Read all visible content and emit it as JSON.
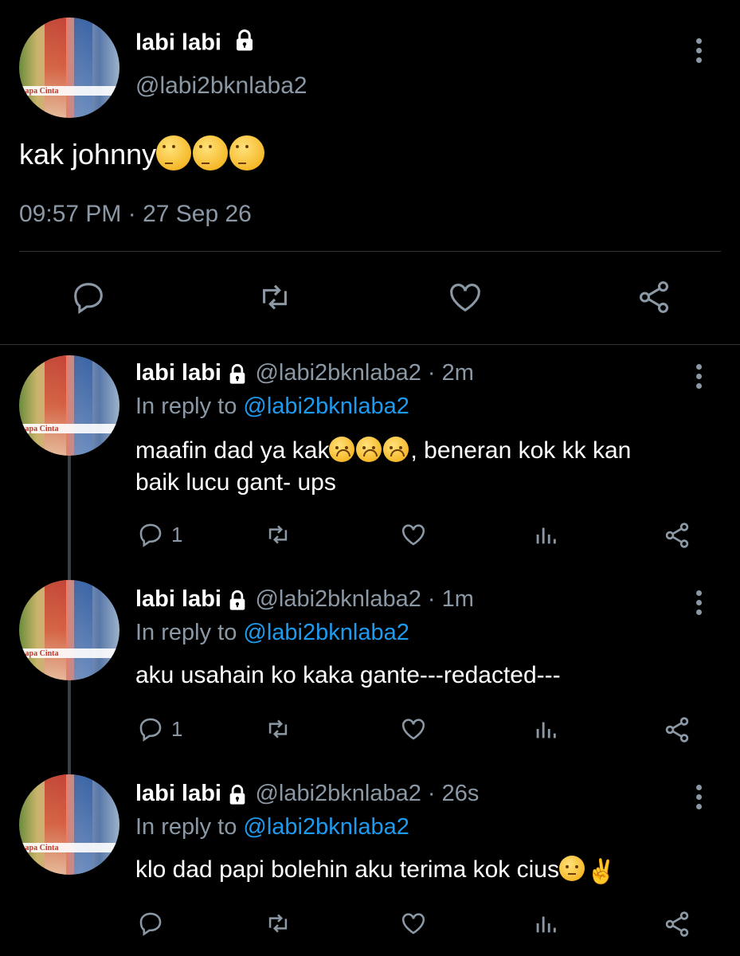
{
  "main_tweet": {
    "name": "labi labi",
    "handle": "@labi2bknlaba2",
    "text": "kak johnny",
    "timestamp": "09:57 PM · 27 Sep 26"
  },
  "avatar_logo": "apa Cinta",
  "replies": [
    {
      "name": "labi labi",
      "handle_time": "@labi2bknlaba2 · 2m",
      "reply_prefix": "In reply to",
      "reply_to": "@labi2bknlaba2",
      "text_before": "maafin dad ya kak",
      "text_after": ", beneran kok kk kan",
      "text_line2": "baik lucu gant- ups",
      "reply_count": "1"
    },
    {
      "name": "labi labi",
      "handle_time": "@labi2bknlaba2 · 1m",
      "reply_prefix": "In reply to",
      "reply_to": "@labi2bknlaba2",
      "text": "aku usahain ko kaka gante---redacted---",
      "reply_count": "1"
    },
    {
      "name": "labi labi",
      "handle_time": "@labi2bknlaba2 · 26s",
      "reply_prefix": "In reply to",
      "reply_to": "@labi2bknlaba2",
      "text": "klo dad papi bolehin aku terima kok cius",
      "reply_count": ""
    }
  ],
  "icons": [
    "lock-icon",
    "more-icon",
    "reply-icon",
    "retweet-icon",
    "like-icon",
    "share-icon",
    "analytics-icon"
  ]
}
